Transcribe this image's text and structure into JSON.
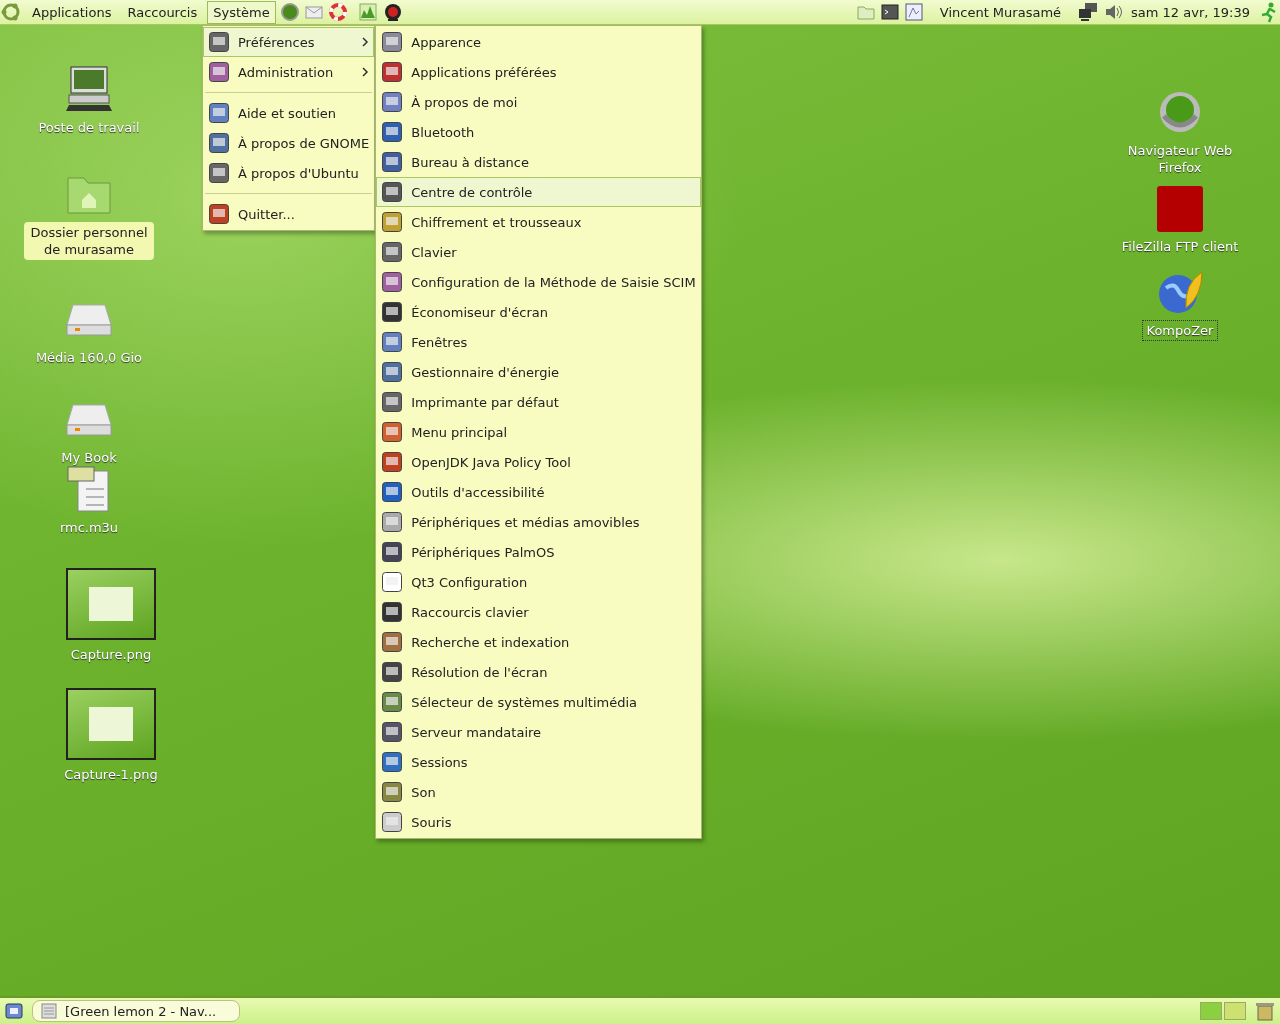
{
  "top_panel": {
    "menus": [
      {
        "label": "Applications",
        "selected": false
      },
      {
        "label": "Raccourcis",
        "selected": false
      },
      {
        "label": "Système",
        "selected": true
      }
    ],
    "user": "Vincent Murasamé",
    "clock": "sam 12 avr, 19:39"
  },
  "desktop_icons": [
    {
      "label": "Poste de travail",
      "kind": "computer",
      "selected": false,
      "focused": false
    },
    {
      "label": "Dossier personnel de murasame",
      "kind": "folder",
      "selected": true,
      "focused": false
    },
    {
      "label": "Média 160,0 Gio",
      "kind": "drive",
      "selected": false,
      "focused": false
    },
    {
      "label": "My Book",
      "kind": "drive",
      "selected": false,
      "focused": false
    },
    {
      "label": "rmc.m3u",
      "kind": "playlist",
      "selected": false,
      "focused": false
    },
    {
      "label": "Capture.png",
      "kind": "image",
      "selected": false,
      "focused": false
    },
    {
      "label": "Capture-1.png",
      "kind": "image",
      "selected": false,
      "focused": false
    },
    {
      "label": "Navigateur Web Firefox",
      "kind": "browser",
      "selected": false,
      "focused": false
    },
    {
      "label": "FileZilla FTP client",
      "kind": "ftp",
      "selected": false,
      "focused": false
    },
    {
      "label": "KompoZer",
      "kind": "editor",
      "selected": false,
      "focused": true
    }
  ],
  "system_menu": {
    "items": [
      {
        "kind": "submenu",
        "label": "Préférences",
        "selected": true
      },
      {
        "kind": "submenu",
        "label": "Administration",
        "selected": false
      },
      {
        "kind": "separator"
      },
      {
        "kind": "item",
        "label": "Aide et soutien",
        "selected": false
      },
      {
        "kind": "item",
        "label": "À propos de GNOME",
        "selected": false
      },
      {
        "kind": "item",
        "label": "À propos d'Ubuntu",
        "selected": false
      },
      {
        "kind": "separator"
      },
      {
        "kind": "item",
        "label": "Quitter...",
        "selected": false
      }
    ]
  },
  "preferences_menu": {
    "items": [
      {
        "label": "Apparence",
        "selected": false
      },
      {
        "label": "Applications préférées",
        "selected": false
      },
      {
        "label": "À propos de moi",
        "selected": false
      },
      {
        "label": "Bluetooth",
        "selected": false
      },
      {
        "label": "Bureau à distance",
        "selected": false
      },
      {
        "label": "Centre de contrôle",
        "selected": true
      },
      {
        "label": "Chiffrement et trousseaux",
        "selected": false
      },
      {
        "label": "Clavier",
        "selected": false
      },
      {
        "label": "Configuration de la Méthode de Saisie SCIM",
        "selected": false
      },
      {
        "label": "Économiseur d'écran",
        "selected": false
      },
      {
        "label": "Fenêtres",
        "selected": false
      },
      {
        "label": "Gestionnaire d'énergie",
        "selected": false
      },
      {
        "label": "Imprimante par défaut",
        "selected": false
      },
      {
        "label": "Menu principal",
        "selected": false
      },
      {
        "label": "OpenJDK Java  Policy Tool",
        "selected": false
      },
      {
        "label": "Outils d'accessibilité",
        "selected": false
      },
      {
        "label": "Périphériques et médias amovibles",
        "selected": false
      },
      {
        "label": "Périphériques PalmOS",
        "selected": false
      },
      {
        "label": "Qt3 Configuration",
        "selected": false
      },
      {
        "label": "Raccourcis clavier",
        "selected": false
      },
      {
        "label": "Recherche et indexation",
        "selected": false
      },
      {
        "label": "Résolution de l'écran",
        "selected": false
      },
      {
        "label": "Sélecteur de systèmes multimédia",
        "selected": false
      },
      {
        "label": "Serveur mandataire",
        "selected": false
      },
      {
        "label": "Sessions",
        "selected": false
      },
      {
        "label": "Son",
        "selected": false
      },
      {
        "label": "Souris",
        "selected": false
      }
    ]
  },
  "taskbar": {
    "tasks": [
      {
        "label": "[Green lemon 2 - Nav...",
        "selected": false
      }
    ]
  }
}
